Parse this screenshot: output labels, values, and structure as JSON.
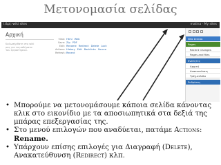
{
  "slide": {
    "title": "Μετονομασία σελίδας"
  },
  "screenshot": {
    "topbar": {
      "logo": "i.&pi;-wiki sites",
      "user": "matina · My sites"
    },
    "page": {
      "heading": "Αρχική",
      "body_lines": [
        "Καλωσήρθατε στο wiki",
        "μας για τα μαθήματα",
        "του εργαστηρίου."
      ]
    },
    "infobox": {
      "rows": [
        {
          "label": "View:",
          "values": [
            "Html",
            "Web"
          ]
        },
        {
          "label": "Save:",
          "values": [
            "Zip",
            "PDF"
          ]
        },
        {
          "label": "Edit:",
          "values": [
            "Rename",
            "Redirect",
            "Delete",
            "Lock"
          ]
        },
        {
          "label": "Actions:",
          "values": [
            "History",
            "Edit",
            "Backlinks",
            "Source"
          ]
        },
        {
          "label": "Refresh:",
          "values": [
            "Recent"
          ]
        }
      ]
    },
    "sidebar": {
      "sections": [
        {
          "title": "Νέα Σελίδα",
          "color": "#3a7bc8",
          "items": []
        },
        {
          "title": "Pages",
          "color": "#4a8a2e",
          "items": [
            "Recent Changes",
            "Pages and files"
          ]
        },
        {
          "title": "Ενότητες",
          "color": "#2e6db4",
          "items": [
            "Αρχική",
            "Ανακοινώσεις",
            "Τρέχ.σελίδα"
          ]
        },
        {
          "title": "Ρυθμίσεις",
          "color": "#2e6db4",
          "items": []
        }
      ]
    },
    "colors": {
      "topbar": "#2b2b2b",
      "link": "#2a6bb3",
      "arrow": "#222222"
    }
  },
  "bullets": [
    "Μπορούμε να μετονομάσουμε κάποια σελίδα κάνοντας κλικ στο εικονίδιο με τα αποσιωπητικά στα δεξιά της μπάρας επεξεργασίας της.",
    "Στο μενού επιλογών που αναδύεται, πατάμε",
    "Actions:",
    "Rename.",
    "Υπάρχουν επίσης επιλογές για Διαγραφή (",
    "Delete),",
    "Ανακατεύθυνση (",
    "Redirect)",
    "κλπ."
  ]
}
